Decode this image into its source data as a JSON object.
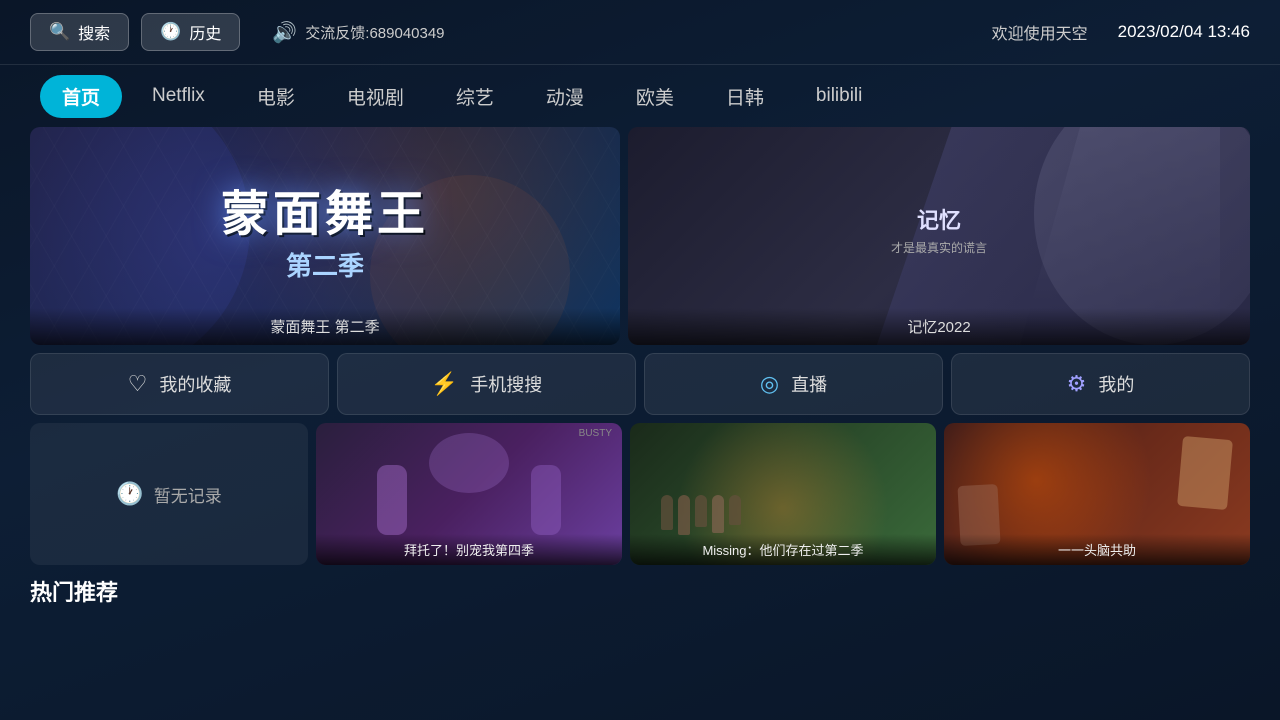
{
  "topbar": {
    "search_label": "搜索",
    "history_label": "历史",
    "feedback_label": "交流反馈:689040349",
    "welcome": "欢迎使用天空",
    "datetime": "2023/02/04 13:46"
  },
  "nav": {
    "items": [
      {
        "id": "home",
        "label": "首页",
        "active": true
      },
      {
        "id": "netflix",
        "label": "Netflix",
        "active": false
      },
      {
        "id": "movie",
        "label": "电影",
        "active": false
      },
      {
        "id": "tv",
        "label": "电视剧",
        "active": false
      },
      {
        "id": "variety",
        "label": "综艺",
        "active": false
      },
      {
        "id": "anime",
        "label": "动漫",
        "active": false
      },
      {
        "id": "western",
        "label": "欧美",
        "active": false
      },
      {
        "id": "korean",
        "label": "日韩",
        "active": false
      },
      {
        "id": "bilibili",
        "label": "bilibili",
        "active": false
      }
    ]
  },
  "banners": {
    "left": {
      "title": "蒙面舞王",
      "subtitle": "第二季",
      "caption": "蒙面舞王 第二季"
    },
    "right": {
      "title": "记忆",
      "subtitle": "才是最真实的谎言",
      "caption": "记忆2022"
    }
  },
  "quick_actions": [
    {
      "id": "favorites",
      "icon": "♡",
      "label": "我的收藏"
    },
    {
      "id": "mobile-search",
      "icon": "⚡",
      "label": "手机搜搜"
    },
    {
      "id": "live",
      "icon": "◎",
      "label": "直播"
    },
    {
      "id": "mine",
      "icon": "⚙",
      "label": "我的"
    }
  ],
  "recent": {
    "empty_label": "暂无记录",
    "cards": [
      {
        "id": "drama1",
        "title": "拜托了！别宠我第四季",
        "bg": "1"
      },
      {
        "id": "drama2",
        "title": "Missing：他们存在过第二季",
        "bg": "2"
      },
      {
        "id": "drama3",
        "title": "一一头脑共助",
        "bg": "3"
      }
    ]
  },
  "section": {
    "hot_title": "热门推荐"
  }
}
